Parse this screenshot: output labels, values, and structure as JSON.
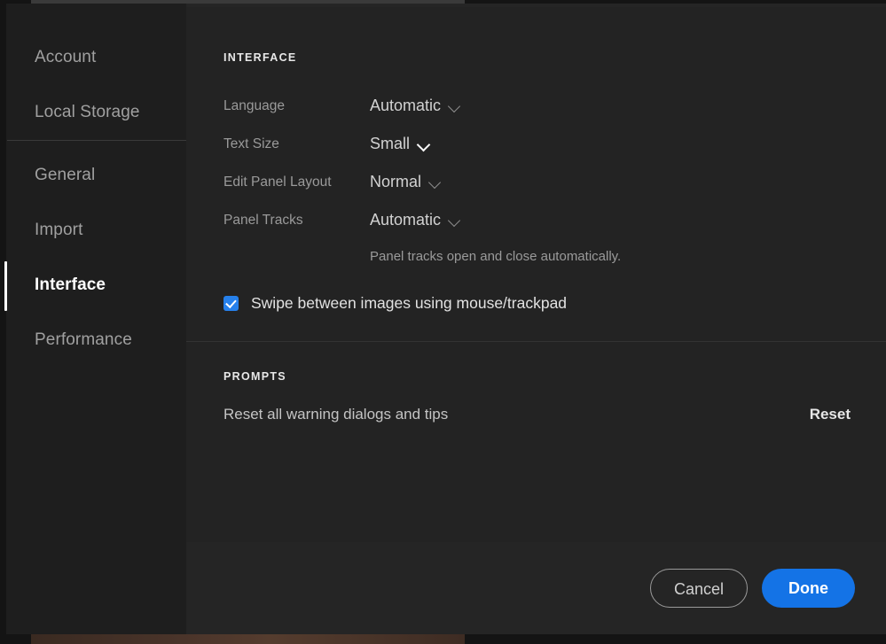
{
  "sidebar": {
    "groups": [
      {
        "items": [
          {
            "label": "Account",
            "selected": false
          },
          {
            "label": "Local Storage",
            "selected": false
          }
        ]
      },
      {
        "items": [
          {
            "label": "General",
            "selected": false
          },
          {
            "label": "Import",
            "selected": false
          },
          {
            "label": "Interface",
            "selected": true
          },
          {
            "label": "Performance",
            "selected": false
          }
        ]
      }
    ]
  },
  "content": {
    "interface": {
      "title": "INTERFACE",
      "fields": [
        {
          "label": "Language",
          "value": "Automatic",
          "icon": "chevron-down-icon",
          "hover": false
        },
        {
          "label": "Text Size",
          "value": "Small",
          "icon": "chevron-down-icon",
          "hover": true
        },
        {
          "label": "Edit Panel Layout",
          "value": "Normal",
          "icon": "chevron-down-icon",
          "hover": false
        },
        {
          "label": "Panel Tracks",
          "value": "Automatic",
          "icon": "chevron-down-icon",
          "hover": false
        }
      ],
      "helper_text": "Panel tracks open and close automatically.",
      "checkbox": {
        "label": "Swipe between images using mouse/trackpad",
        "checked": true,
        "color": "#2680eb"
      }
    },
    "prompts": {
      "title": "PROMPTS",
      "row_label": "Reset all warning dialogs and tips",
      "reset_label": "Reset"
    }
  },
  "footer": {
    "cancel_label": "Cancel",
    "done_label": "Done",
    "done_color": "#1473e6"
  }
}
